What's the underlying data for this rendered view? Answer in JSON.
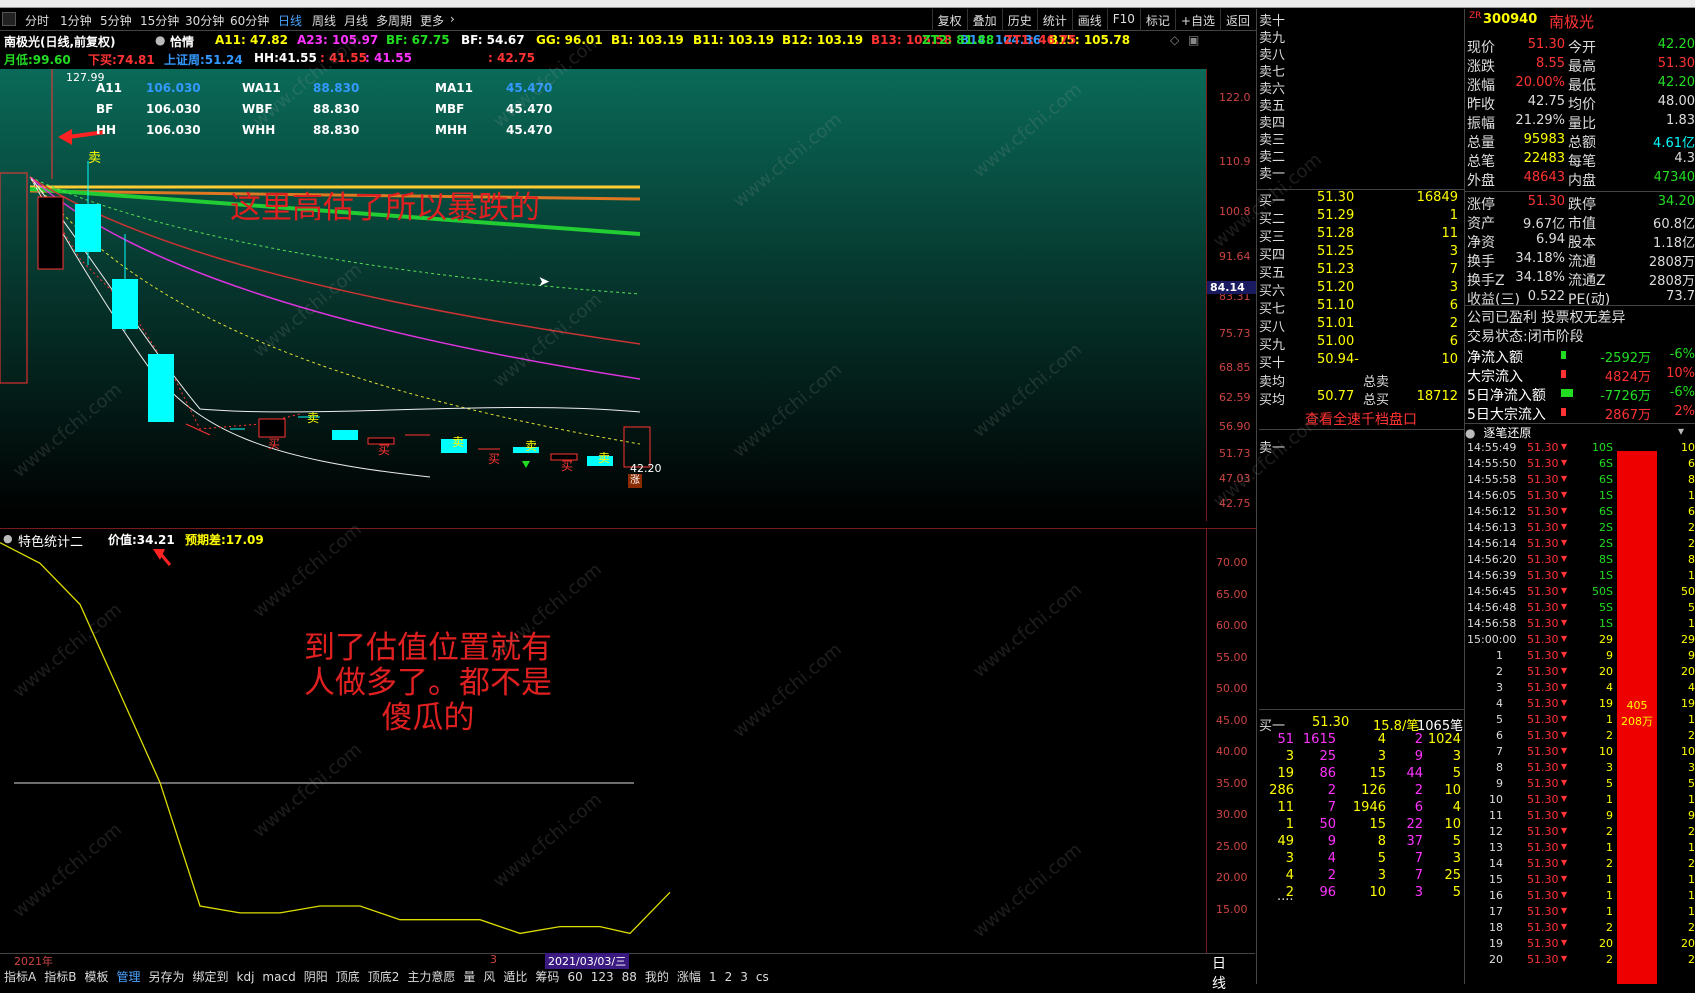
{
  "periods": {
    "items": [
      "分时",
      "1分钟",
      "5分钟",
      "15分钟",
      "30分钟",
      "60分钟",
      "日线",
      "周线",
      "月线",
      "多周期",
      "更多"
    ],
    "active": "日线"
  },
  "toolbar": {
    "items": [
      "复权",
      "叠加",
      "历史",
      "统计",
      "画线",
      "F10",
      "标记",
      "+自选",
      "返回"
    ]
  },
  "title": {
    "stock": "南极光(日线,前复权)",
    "qingxu": "恰情",
    "ma": [
      {
        "label": "A11: 47.82",
        "color": "#ffff00"
      },
      {
        "label": "A23: 105.97",
        "color": "#ff33ff"
      },
      {
        "label": "BF: 67.75",
        "color": "#22dd22"
      },
      {
        "label": "BF: 54.67",
        "color": "#ffffff"
      },
      {
        "label": "GG: 96.01",
        "color": "#ffff00"
      },
      {
        "label": "B1: 103.19",
        "color": "#ffff00"
      },
      {
        "label": "B11: 103.19",
        "color": "#ffff00"
      },
      {
        "label": "B12: 103.19",
        "color": "#ffff00"
      },
      {
        "label": "B13: 105.58",
        "color": "#ff3333"
      },
      {
        "label": "B14: 104.36",
        "color": "#3399ff"
      },
      {
        "label": "B15: 105.78",
        "color": "#ffff00"
      },
      {
        "label": "ZT2: 81.88",
        "color": "#22dd22"
      },
      {
        "label": "ZT1: 46.75",
        "color": "#ff3333"
      }
    ]
  },
  "info": {
    "yuedi": "月低:99.60",
    "xiamai": "下买:74.81",
    "shangzhou": "上证周:51.24",
    "hh": "HH:41.55",
    "v1": ": 41.55",
    "v2": ": 41.55",
    "v3": ": 42.75"
  },
  "legend": {
    "rows": [
      [
        "A11",
        "106.030",
        "WA11",
        "88.830",
        "MA11",
        "45.470"
      ],
      [
        "BF",
        "106.030",
        "WBF",
        "88.830",
        "MBF",
        "45.470"
      ],
      [
        "HH",
        "106.030",
        "WHH",
        "88.830",
        "MHH",
        "45.470"
      ]
    ]
  },
  "chart_labels": {
    "high": "127.99",
    "low": "42.20",
    "cursor": "84.14",
    "annotation_main": "这里高估了所以暴跌的",
    "annotation_sub": [
      "到了估值位置就有",
      "人做多了。都不是",
      "傻瓜的"
    ],
    "sell_mark": "卖",
    "buy_mark": "买",
    "zhang_mark": "涨"
  },
  "price_axis": [
    "122.0",
    "110.9",
    "100.8",
    "91.64",
    "83.31",
    "75.73",
    "68.85",
    "62.59",
    "56.90",
    "51.73",
    "47.03",
    "42.75"
  ],
  "sub": {
    "name": "特色统计二",
    "value_label": "价值:34.21",
    "expect_label": "预期差:17.09"
  },
  "sub_axis": [
    "70.00",
    "65.00",
    "60.00",
    "55.00",
    "50.00",
    "45.00",
    "40.00",
    "35.00",
    "30.00",
    "25.00",
    "20.00",
    "15.00"
  ],
  "chart_data": {
    "type": "line",
    "series": [
      {
        "values": [
          72,
          69,
          63,
          50,
          37,
          19,
          18,
          18,
          19,
          19,
          17,
          17,
          17,
          15,
          16,
          16,
          15,
          21
        ]
      }
    ],
    "ylim": [
      12,
      74
    ]
  },
  "date": {
    "year": "2021年",
    "mark": "3",
    "current": "2021/03/03/三"
  },
  "tabs": [
    "指标A",
    "指标B",
    "模板",
    "管理",
    "另存为",
    "绑定到",
    "kdj",
    "macd",
    "阴阳",
    "顶底",
    "顶底2",
    "主力意愿",
    "量",
    "风",
    "遁比",
    "筹码",
    "60",
    "123",
    "88",
    "我的",
    "涨幅",
    "1",
    "2",
    "3",
    "cs"
  ],
  "tabs_active": "管理",
  "period_label": "日线",
  "sell": [
    {
      "label": "卖十"
    },
    {
      "label": "卖九"
    },
    {
      "label": "卖八"
    },
    {
      "label": "卖七"
    },
    {
      "label": "卖六"
    },
    {
      "label": "卖五"
    },
    {
      "label": "卖四"
    },
    {
      "label": "卖三"
    },
    {
      "label": "卖二"
    },
    {
      "label": "卖一"
    }
  ],
  "buy": [
    {
      "label": "买一",
      "price": "51.30",
      "vol": "16849"
    },
    {
      "label": "买二",
      "price": "51.29",
      "vol": "1"
    },
    {
      "label": "买三",
      "price": "51.28",
      "vol": "11"
    },
    {
      "label": "买四",
      "price": "51.25",
      "vol": "3"
    },
    {
      "label": "买五",
      "price": "51.23",
      "vol": "7"
    },
    {
      "label": "买六",
      "price": "51.20",
      "vol": "3"
    },
    {
      "label": "买七",
      "price": "51.10",
      "vol": "6"
    },
    {
      "label": "买八",
      "price": "51.01",
      "vol": "2"
    },
    {
      "label": "买九",
      "price": "51.00",
      "vol": "6"
    },
    {
      "label": "买十",
      "price": "50.94-",
      "vol": "10"
    }
  ],
  "avg": {
    "sell_label": "卖均",
    "total_sell_label": "总卖",
    "buy_label": "买均",
    "buy_avg": "50.77",
    "total_buy_label": "总买",
    "total_buy": "18712"
  },
  "view_link": "查看全速千档盘口",
  "sell_one_label": "卖一",
  "buy_one": {
    "label": "买一",
    "price": "51.30",
    "per": "15.8/笔",
    "count": "1065笔"
  },
  "queue": [
    [
      "51",
      "1615",
      "4",
      "2",
      "1024"
    ],
    [
      "3",
      "25",
      "3",
      "9",
      "3"
    ],
    [
      "19",
      "86",
      "15",
      "44",
      "5"
    ],
    [
      "286",
      "2",
      "126",
      "2",
      "10"
    ],
    [
      "11",
      "7",
      "1946",
      "6",
      "4"
    ],
    [
      "1",
      "50",
      "15",
      "22",
      "10"
    ],
    [
      "49",
      "9",
      "8",
      "37",
      "5"
    ],
    [
      "3",
      "4",
      "5",
      "7",
      "3"
    ],
    [
      "4",
      "2",
      "3",
      "7",
      "25"
    ],
    [
      "2",
      "96",
      "10",
      "3",
      "5"
    ]
  ],
  "queue_more": "....",
  "quote": {
    "code": "300940",
    "name": "南极光",
    "prefix": "ZR",
    "rows": [
      [
        "现价",
        "51.30",
        "今开",
        "42.20"
      ],
      [
        "涨跌",
        "8.55",
        "最高",
        "51.30"
      ],
      [
        "涨幅",
        "20.00%",
        "最低",
        "42.20"
      ],
      [
        "昨收",
        "42.75",
        "均价",
        "48.00"
      ],
      [
        "振幅",
        "21.29%",
        "量比",
        "1.83"
      ],
      [
        "总量",
        "95983",
        "总额",
        "4.61亿"
      ],
      [
        "总笔",
        "22483",
        "每笔",
        "4.3"
      ],
      [
        "外盘",
        "48643",
        "内盘",
        "47340"
      ]
    ],
    "rows2": [
      [
        "涨停",
        "51.30",
        "跌停",
        "34.20"
      ],
      [
        "资产",
        "9.67亿",
        "市值",
        "60.8亿"
      ],
      [
        "净资",
        "6.94",
        "股本",
        "1.18亿"
      ],
      [
        "换手",
        "34.18%",
        "流通",
        "2808万"
      ],
      [
        "换手Z",
        "34.18%",
        "流通Z",
        "2808万"
      ],
      [
        "收益(三)",
        "0.522",
        "PE(动)",
        "73.7"
      ]
    ],
    "notice": "公司已盈利 投票权无差异",
    "status": "交易状态:闭市阶段",
    "flows": [
      {
        "label": "净流入额",
        "value": "-2592万",
        "pct": "-6%",
        "color": "#22dd22"
      },
      {
        "label": "大宗流入",
        "value": "4824万",
        "pct": "10%",
        "color": "#ff3333"
      },
      {
        "label": "5日净流入额",
        "value": "-7726万",
        "pct": "-6%",
        "color": "#22dd22"
      },
      {
        "label": "5日大宗流入",
        "value": "2867万",
        "pct": "2%",
        "color": "#ff3333"
      }
    ]
  },
  "ticks": {
    "title": "逐笔还原",
    "rows": [
      [
        "14:55:49",
        "51.30",
        "10S"
      ],
      [
        "14:55:50",
        "51.30",
        "6S"
      ],
      [
        "14:55:58",
        "51.30",
        "6S"
      ],
      [
        "14:56:05",
        "51.30",
        "1S"
      ],
      [
        "14:56:12",
        "51.30",
        "6S"
      ],
      [
        "14:56:13",
        "51.30",
        "2S"
      ],
      [
        "14:56:14",
        "51.30",
        "2S"
      ],
      [
        "14:56:20",
        "51.30",
        "8S"
      ],
      [
        "14:56:39",
        "51.30",
        "1S"
      ],
      [
        "14:56:45",
        "51.30",
        "50S"
      ],
      [
        "14:56:48",
        "51.30",
        "5S"
      ],
      [
        "14:56:58",
        "51.30",
        "1S"
      ],
      [
        "15:00:00",
        "51.30",
        "29"
      ],
      [
        "1",
        "51.30",
        "9"
      ],
      [
        "2",
        "51.30",
        "20"
      ],
      [
        "3",
        "51.30",
        "4"
      ],
      [
        "4",
        "51.30",
        "19"
      ],
      [
        "5",
        "51.30",
        "1"
      ],
      [
        "6",
        "51.30",
        "2"
      ],
      [
        "7",
        "51.30",
        "10"
      ],
      [
        "8",
        "51.30",
        "3"
      ],
      [
        "9",
        "51.30",
        "5"
      ],
      [
        "10",
        "51.30",
        "1"
      ],
      [
        "11",
        "51.30",
        "9"
      ],
      [
        "12",
        "51.30",
        "2"
      ],
      [
        "13",
        "51.30",
        "1"
      ],
      [
        "14",
        "51.30",
        "2"
      ],
      [
        "15",
        "51.30",
        "1"
      ],
      [
        "16",
        "51.30",
        "1"
      ],
      [
        "17",
        "51.30",
        "1"
      ],
      [
        "18",
        "51.30",
        "2"
      ],
      [
        "19",
        "51.30",
        "20"
      ],
      [
        "20",
        "51.30",
        "2"
      ]
    ],
    "bar_label1": "405",
    "bar_label2": "208万",
    "right_col": [
      "10",
      "6",
      "8",
      "1",
      "6",
      "2",
      "2",
      "8",
      "1",
      "50",
      "5",
      "1",
      "29",
      "9",
      "20",
      "4",
      "19",
      "1",
      "2",
      "10",
      "3",
      "5",
      "1",
      "9",
      "2",
      "1",
      "2",
      "1",
      "1",
      "1",
      "2",
      "20",
      "2"
    ]
  },
  "watermark": "www.cfchi.com"
}
